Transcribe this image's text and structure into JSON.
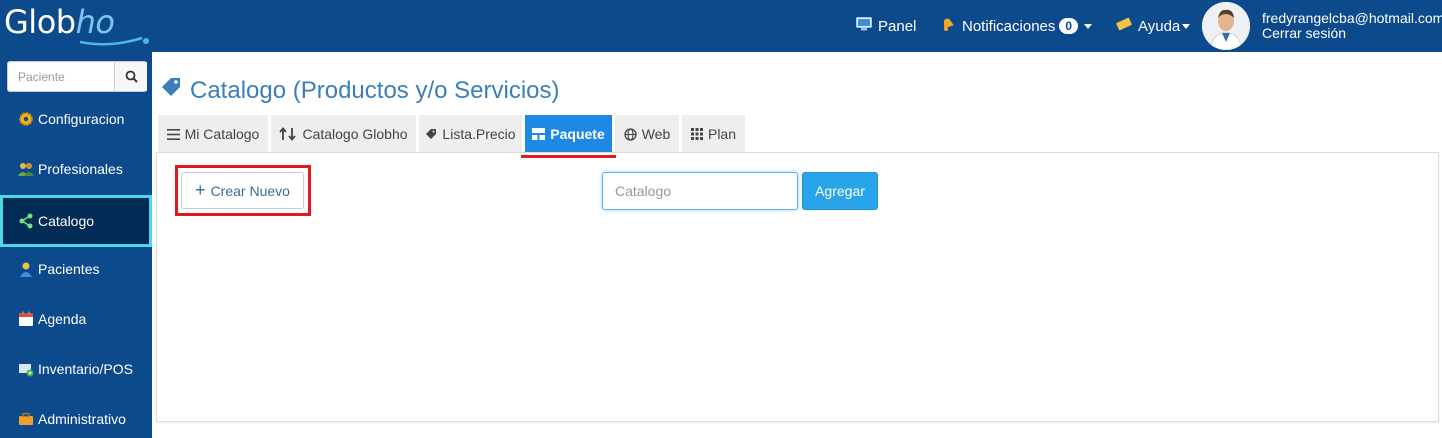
{
  "header": {
    "logo_main": "Glob",
    "logo_accent": "ho",
    "nav": {
      "panel": "Panel",
      "notifications": "Notificaciones",
      "notifications_count": "0",
      "help": "Ayuda"
    },
    "user": {
      "email": "fredyrangelcba@hotmail.com",
      "logout": "Cerrar sesión"
    }
  },
  "sidebar": {
    "search_placeholder": "Paciente",
    "items": [
      {
        "label": "Configuracion",
        "icon": "gear-icon"
      },
      {
        "label": "Profesionales",
        "icon": "people-icon"
      },
      {
        "label": "Catalogo",
        "icon": "share-nodes-icon"
      },
      {
        "label": "Pacientes",
        "icon": "person-icon"
      },
      {
        "label": "Agenda",
        "icon": "calendar-icon"
      },
      {
        "label": "Inventario/POS",
        "icon": "inventory-icon"
      },
      {
        "label": "Administrativo",
        "icon": "briefcase-icon"
      }
    ],
    "active_item": "Catalogo"
  },
  "main": {
    "title": "Catalogo (Productos y/o Servicios)",
    "tabs": [
      {
        "label": "Mi Catalogo",
        "icon": "list-icon"
      },
      {
        "label": "Catalogo Globho",
        "icon": "sort-arrows-icon"
      },
      {
        "label": "Lista.Precio",
        "icon": "tag-icon"
      },
      {
        "label": "Paquete",
        "icon": "layout-icon"
      },
      {
        "label": "Web",
        "icon": "globe-icon"
      },
      {
        "label": "Plan",
        "icon": "grid-icon"
      }
    ],
    "active_tab": "Paquete",
    "create_button": "Crear Nuevo",
    "catalog_input_placeholder": "Catalogo",
    "add_button": "Agregar"
  },
  "colors": {
    "brand": "#0d4a8c",
    "active_tab": "#1e88e5",
    "highlight": "#e11a22",
    "add_button": "#29a3ea",
    "title": "#3a7fb9"
  }
}
